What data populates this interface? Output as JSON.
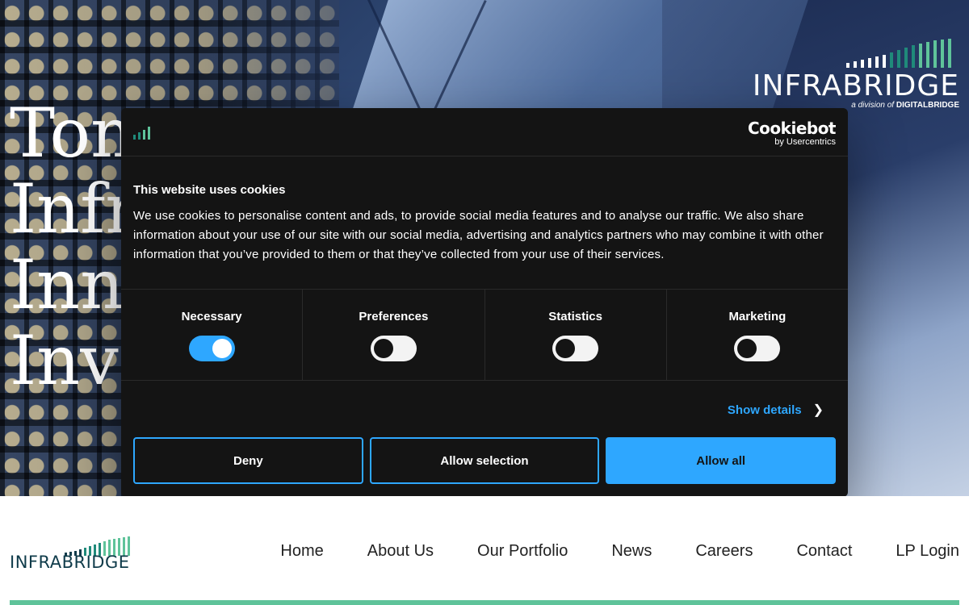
{
  "hero": {
    "title_lines": [
      "Tom",
      "Infr",
      "Inno",
      "Inve"
    ]
  },
  "brand": {
    "name": "INFRABRIDGE",
    "division_prefix": "a division of",
    "division_name": "DIGITALBRIDGE",
    "colors": {
      "teal": "#1f8a7a",
      "green": "#5fc39a",
      "navy": "#0f3b4a"
    }
  },
  "cookie_dialog": {
    "provider_name": "Cookiebot",
    "provider_by": "by Usercentrics",
    "heading": "This website uses cookies",
    "body": "We use cookies to personalise content and ads, to provide social media features and to analyse our traffic. We also share information about your use of our site with our social media, advertising and analytics partners who may combine it with other information that you’ve provided to them or that they’ve collected from your use of their services.",
    "categories": [
      {
        "label": "Necessary",
        "enabled": true
      },
      {
        "label": "Preferences",
        "enabled": false
      },
      {
        "label": "Statistics",
        "enabled": false
      },
      {
        "label": "Marketing",
        "enabled": false
      }
    ],
    "show_details_label": "Show details",
    "buttons": {
      "deny": "Deny",
      "allow_selection": "Allow selection",
      "allow_all": "Allow all"
    },
    "accent_color": "#2ea7ff"
  },
  "nav": {
    "logo_text": "INFRABRIDGE",
    "items": [
      "Home",
      "About Us",
      "Our Portfolio",
      "News",
      "Careers",
      "Contact",
      "LP Login"
    ]
  }
}
